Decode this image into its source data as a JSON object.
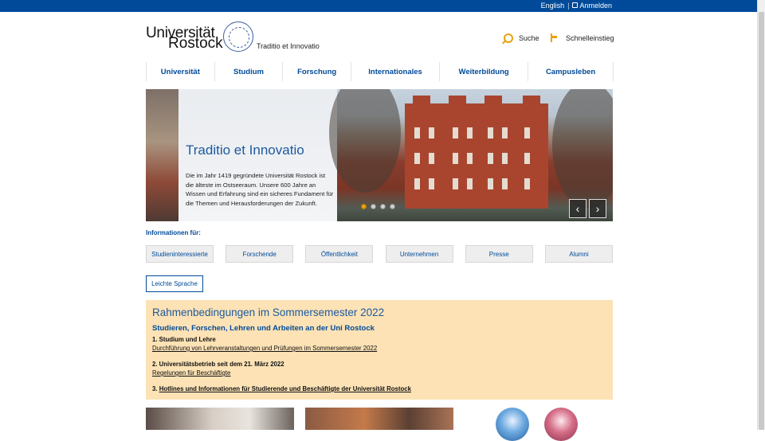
{
  "topbar": {
    "lang_label": "English",
    "separator": "|",
    "login_label": "Anmelden"
  },
  "header": {
    "logo_line1": "Universität",
    "logo_line2": "Rostock",
    "motto": "Traditio et Innovatio",
    "search_label": "Suche",
    "quickaccess_label": "Schnelleinstieg"
  },
  "nav": {
    "items": [
      "Universität",
      "Studium",
      "Forschung",
      "Internationales",
      "Weiterbildung",
      "Campusleben"
    ]
  },
  "hero": {
    "title": "Traditio et Innovatio",
    "description": "Die im Jahr 1419 gegründete Universität Rostock ist die älteste im Ostseeraum. Unsere 600 Jahre an Wissen und Erfahrung sind ein sicheres Fundament für die Themen und Herausforderungen der Zukunft.",
    "slide_count": 4,
    "active_slide": 1,
    "prev_symbol": "‹",
    "next_symbol": "›"
  },
  "audience": {
    "label": "Informationen für:",
    "items": [
      "Studieninteressierte",
      "Forschende",
      "Öffentlichkeit",
      "Unternehmen",
      "Presse",
      "Alumni"
    ]
  },
  "easy_language": {
    "label": "Leichte Sprache"
  },
  "notice": {
    "title": "Rahmenbedingungen im Sommersemester 2022",
    "subtitle": "Studieren, Forschen, Lehren und Arbeiten an der Uni Rostock",
    "s1_heading": "1. Studium und Lehre",
    "s1_link": "Durchführung von Lehrveranstaltungen und Prüfungen im Sommersemester 2022",
    "s2_heading": "2. Universitätsbetrieb seit dem 21. März 2022",
    "s2_link": "Regelungen für Beschäftigte",
    "s3_prefix": "3.",
    "s3_link": "Hotlines und Informationen für Studierende und Beschäftigte der Universität Rostock"
  },
  "colors": {
    "brand_blue": "#004a99",
    "accent_orange": "#e8a20c",
    "notice_bg": "#fce2b5"
  }
}
